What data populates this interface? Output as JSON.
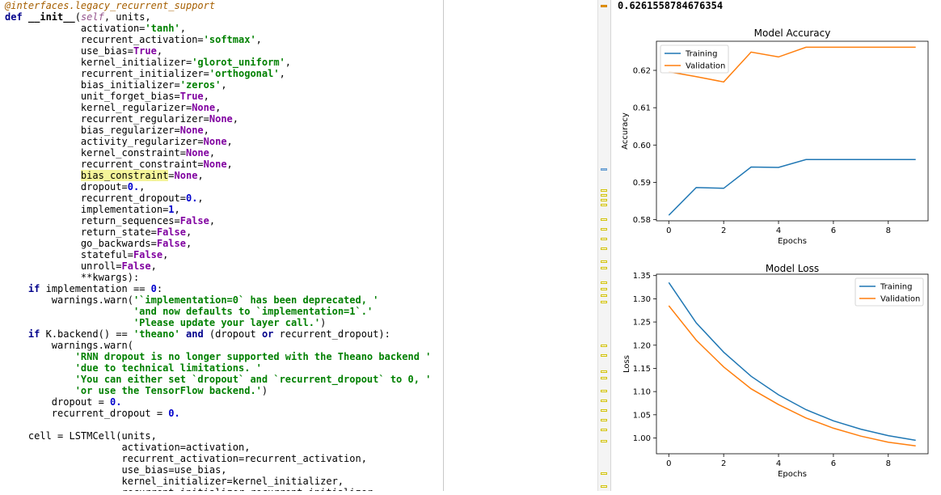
{
  "code": {
    "lines": [
      [
        {
          "t": "@interfaces.legacy_recurrent_support",
          "c": "dec"
        }
      ],
      [
        {
          "t": "def ",
          "c": "kw"
        },
        {
          "t": "__init__",
          "c": "name"
        },
        {
          "t": "(",
          "c": "plain"
        },
        {
          "t": "self",
          "c": "self"
        },
        {
          "t": ", units,",
          "c": "plain"
        }
      ],
      [
        {
          "t": "             activation=",
          "c": "plain"
        },
        {
          "t": "'tanh'",
          "c": "str"
        },
        {
          "t": ",",
          "c": "plain"
        }
      ],
      [
        {
          "t": "             recurrent_activation=",
          "c": "plain"
        },
        {
          "t": "'softmax'",
          "c": "str"
        },
        {
          "t": ",",
          "c": "plain"
        }
      ],
      [
        {
          "t": "             use_bias=",
          "c": "plain"
        },
        {
          "t": "True",
          "c": "const"
        },
        {
          "t": ",",
          "c": "plain"
        }
      ],
      [
        {
          "t": "             kernel_initializer=",
          "c": "plain"
        },
        {
          "t": "'glorot_uniform'",
          "c": "str"
        },
        {
          "t": ",",
          "c": "plain"
        }
      ],
      [
        {
          "t": "             recurrent_initializer=",
          "c": "plain"
        },
        {
          "t": "'orthogonal'",
          "c": "str"
        },
        {
          "t": ",",
          "c": "plain"
        }
      ],
      [
        {
          "t": "             bias_initializer=",
          "c": "plain"
        },
        {
          "t": "'zeros'",
          "c": "str"
        },
        {
          "t": ",",
          "c": "plain"
        }
      ],
      [
        {
          "t": "             unit_forget_bias=",
          "c": "plain"
        },
        {
          "t": "True",
          "c": "const"
        },
        {
          "t": ",",
          "c": "plain"
        }
      ],
      [
        {
          "t": "             kernel_regularizer=",
          "c": "plain"
        },
        {
          "t": "None",
          "c": "const"
        },
        {
          "t": ",",
          "c": "plain"
        }
      ],
      [
        {
          "t": "             recurrent_regularizer=",
          "c": "plain"
        },
        {
          "t": "None",
          "c": "const"
        },
        {
          "t": ",",
          "c": "plain"
        }
      ],
      [
        {
          "t": "             bias_regularizer=",
          "c": "plain"
        },
        {
          "t": "None",
          "c": "const"
        },
        {
          "t": ",",
          "c": "plain"
        }
      ],
      [
        {
          "t": "             activity_regularizer=",
          "c": "plain"
        },
        {
          "t": "None",
          "c": "const"
        },
        {
          "t": ",",
          "c": "plain"
        }
      ],
      [
        {
          "t": "             kernel_constraint=",
          "c": "plain"
        },
        {
          "t": "None",
          "c": "const"
        },
        {
          "t": ",",
          "c": "plain"
        }
      ],
      [
        {
          "t": "             recurrent_constraint=",
          "c": "plain"
        },
        {
          "t": "None",
          "c": "const"
        },
        {
          "t": ",",
          "c": "plain"
        }
      ],
      [
        {
          "t": "             ",
          "c": "plain"
        },
        {
          "t": "bias_constraint",
          "c": "hl"
        },
        {
          "t": "=",
          "c": "plain"
        },
        {
          "t": "None",
          "c": "const"
        },
        {
          "t": ",",
          "c": "plain"
        }
      ],
      [
        {
          "t": "             dropout=",
          "c": "plain"
        },
        {
          "t": "0.",
          "c": "num"
        },
        {
          "t": ",",
          "c": "plain"
        }
      ],
      [
        {
          "t": "             recurrent_dropout=",
          "c": "plain"
        },
        {
          "t": "0.",
          "c": "num"
        },
        {
          "t": ",",
          "c": "plain"
        }
      ],
      [
        {
          "t": "             implementation=",
          "c": "plain"
        },
        {
          "t": "1",
          "c": "num"
        },
        {
          "t": ",",
          "c": "plain"
        }
      ],
      [
        {
          "t": "             return_sequences=",
          "c": "plain"
        },
        {
          "t": "False",
          "c": "const"
        },
        {
          "t": ",",
          "c": "plain"
        }
      ],
      [
        {
          "t": "             return_state=",
          "c": "plain"
        },
        {
          "t": "False",
          "c": "const"
        },
        {
          "t": ",",
          "c": "plain"
        }
      ],
      [
        {
          "t": "             go_backwards=",
          "c": "plain"
        },
        {
          "t": "False",
          "c": "const"
        },
        {
          "t": ",",
          "c": "plain"
        }
      ],
      [
        {
          "t": "             stateful=",
          "c": "plain"
        },
        {
          "t": "False",
          "c": "const"
        },
        {
          "t": ",",
          "c": "plain"
        }
      ],
      [
        {
          "t": "             unroll=",
          "c": "plain"
        },
        {
          "t": "False",
          "c": "const"
        },
        {
          "t": ",",
          "c": "plain"
        }
      ],
      [
        {
          "t": "             **kwargs):",
          "c": "plain"
        }
      ],
      [
        {
          "t": "    ",
          "c": "plain"
        },
        {
          "t": "if ",
          "c": "kw"
        },
        {
          "t": "implementation == ",
          "c": "plain"
        },
        {
          "t": "0",
          "c": "num"
        },
        {
          "t": ":",
          "c": "plain"
        }
      ],
      [
        {
          "t": "        warnings.warn(",
          "c": "plain"
        },
        {
          "t": "'`implementation=0` has been deprecated, '",
          "c": "str"
        }
      ],
      [
        {
          "t": "                      ",
          "c": "plain"
        },
        {
          "t": "'and now defaults to `implementation=1`.'",
          "c": "str"
        }
      ],
      [
        {
          "t": "                      ",
          "c": "plain"
        },
        {
          "t": "'Please update your layer call.'",
          "c": "str"
        },
        {
          "t": ")",
          "c": "plain"
        }
      ],
      [
        {
          "t": "    ",
          "c": "plain"
        },
        {
          "t": "if ",
          "c": "kw"
        },
        {
          "t": "K.backend() == ",
          "c": "plain"
        },
        {
          "t": "'theano'",
          "c": "str"
        },
        {
          "t": " ",
          "c": "plain"
        },
        {
          "t": "and",
          "c": "kw"
        },
        {
          "t": " (dropout ",
          "c": "plain"
        },
        {
          "t": "or",
          "c": "kw"
        },
        {
          "t": " recurrent_dropout):",
          "c": "plain"
        }
      ],
      [
        {
          "t": "        warnings.warn(",
          "c": "plain"
        }
      ],
      [
        {
          "t": "            ",
          "c": "plain"
        },
        {
          "t": "'RNN dropout is no longer supported with the Theano backend '",
          "c": "str"
        }
      ],
      [
        {
          "t": "            ",
          "c": "plain"
        },
        {
          "t": "'due to technical limitations. '",
          "c": "str"
        }
      ],
      [
        {
          "t": "            ",
          "c": "plain"
        },
        {
          "t": "'You can either set `dropout` and `recurrent_dropout` to 0, '",
          "c": "str"
        }
      ],
      [
        {
          "t": "            ",
          "c": "plain"
        },
        {
          "t": "'or use the TensorFlow backend.'",
          "c": "str"
        },
        {
          "t": ")",
          "c": "plain"
        }
      ],
      [
        {
          "t": "        dropout = ",
          "c": "plain"
        },
        {
          "t": "0.",
          "c": "num"
        }
      ],
      [
        {
          "t": "        recurrent_dropout = ",
          "c": "plain"
        },
        {
          "t": "0.",
          "c": "num"
        }
      ],
      [
        {
          "t": "",
          "c": "plain"
        }
      ],
      [
        {
          "t": "    cell = LSTMCell(units,",
          "c": "plain"
        }
      ],
      [
        {
          "t": "                    activation=activation,",
          "c": "plain"
        }
      ],
      [
        {
          "t": "                    recurrent_activation=recurrent_activation,",
          "c": "plain"
        }
      ],
      [
        {
          "t": "                    use_bias=use_bias,",
          "c": "plain"
        }
      ],
      [
        {
          "t": "                    kernel_initializer=kernel_initializer,",
          "c": "plain"
        }
      ],
      [
        {
          "t": "                    recurrent_initializer=recurrent_initializer,",
          "c": "plain"
        }
      ]
    ]
  },
  "output": {
    "value": "0.6261558784676354"
  },
  "colors": {
    "training": "#1f77b4",
    "validation": "#ff7f0e"
  },
  "chart_data": [
    {
      "type": "line",
      "title": "Model Accuracy",
      "xlabel": "Epochs",
      "ylabel": "Accuracy",
      "x": [
        0,
        1,
        2,
        3,
        4,
        5,
        6,
        7,
        8,
        9
      ],
      "xticks": [
        0,
        2,
        4,
        6,
        8
      ],
      "yticks": [
        0.58,
        0.59,
        0.6,
        0.61,
        0.62
      ],
      "ytick_labels": [
        "0.58",
        "0.59",
        "0.60",
        "0.61",
        "0.62"
      ],
      "xlim": [
        -0.45,
        9.45
      ],
      "ylim": [
        0.5797,
        0.6278
      ],
      "legend": "upper left",
      "series": [
        {
          "name": "Training",
          "values": [
            0.5812,
            0.5886,
            0.5884,
            0.5941,
            0.594,
            0.5961,
            0.5961,
            0.5961,
            0.5961,
            0.5961
          ]
        },
        {
          "name": "Validation",
          "values": [
            0.6196,
            0.6183,
            0.6169,
            0.6249,
            0.6236,
            0.6262,
            0.6262,
            0.6262,
            0.6262,
            0.6262
          ]
        }
      ]
    },
    {
      "type": "line",
      "title": "Model Loss",
      "xlabel": "Epochs",
      "ylabel": "Loss",
      "x": [
        0,
        1,
        2,
        3,
        4,
        5,
        6,
        7,
        8,
        9
      ],
      "xticks": [
        0,
        2,
        4,
        6,
        8
      ],
      "yticks": [
        1.0,
        1.05,
        1.1,
        1.15,
        1.2,
        1.25,
        1.3,
        1.35
      ],
      "ytick_labels": [
        "1.00",
        "1.05",
        "1.10",
        "1.15",
        "1.20",
        "1.25",
        "1.30",
        "1.35"
      ],
      "xlim": [
        -0.45,
        9.45
      ],
      "ylim": [
        0.966,
        1.353
      ],
      "legend": "upper right",
      "series": [
        {
          "name": "Training",
          "values": [
            1.335,
            1.248,
            1.185,
            1.133,
            1.093,
            1.061,
            1.037,
            1.019,
            1.005,
            0.995
          ]
        },
        {
          "name": "Validation",
          "values": [
            1.285,
            1.211,
            1.153,
            1.106,
            1.072,
            1.043,
            1.021,
            1.004,
            0.991,
            0.983
          ]
        }
      ]
    }
  ]
}
